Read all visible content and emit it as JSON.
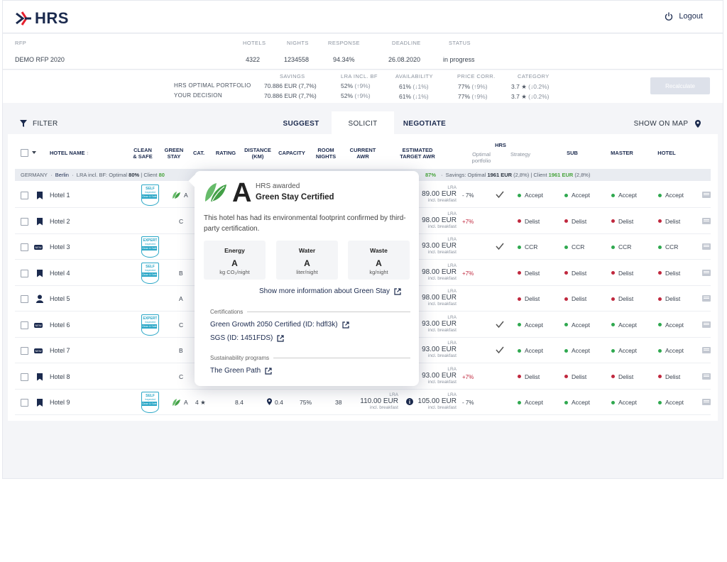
{
  "header": {
    "logo_text": "HRS",
    "logout_label": "Logout"
  },
  "rfp": {
    "labels": {
      "rfp": "RFP",
      "hotels": "HOTELS",
      "nights": "NIGHTS",
      "response": "RESPONSE",
      "deadline": "DEADLINE",
      "status": "STATUS"
    },
    "values": {
      "rfp": "DEMO RFP 2020",
      "hotels": "4322",
      "nights": "1234558",
      "response": "94.34%",
      "deadline": "26.08.2020",
      "status": "in progress"
    }
  },
  "portfolio": {
    "headers": {
      "savings": "SAVINGS",
      "lra": "LRA INCL. BF",
      "availability": "AVAILABILITY",
      "price_corr": "PRICE CORR.",
      "category": "CATEGORY"
    },
    "optimal_label": "HRS OPTIMAL PORTFOLIO",
    "decision_label": "YOUR DECISION",
    "optimal": {
      "savings": "70.886 EUR (7,7%)",
      "lra": "52%",
      "lra_delta": "(↑9%)",
      "availability": "61%",
      "availability_delta": "(↓1%)",
      "price_corr": "77%",
      "price_corr_delta": "(↑9%)",
      "category": "3.7",
      "category_delta": "(↓0.2%)"
    },
    "decision": {
      "savings": "70.886 EUR (7,7%)",
      "lra": "52%",
      "lra_delta": "(↑9%)",
      "availability": "61%",
      "availability_delta": "(↓1%)",
      "price_corr": "77%",
      "price_corr_delta": "(↑9%)",
      "category": "3.7",
      "category_delta": "(↓0.2%)"
    },
    "recalculate_label": "Recalculate"
  },
  "tabs": {
    "filter": "FILTER",
    "suggest": "SUGGEST",
    "solicit": "SOLICIT",
    "negotiate": "NEGOTIATE",
    "show_on_map": "SHOW ON MAP"
  },
  "table": {
    "headers": {
      "hotel_name": "HOTEL NAME",
      "clean_safe": "CLEAN\n& SAFE",
      "green_stay": "GREEN\nSTAY",
      "cat": "CAT.",
      "rating": "RATING",
      "distance": "DISTANCE\n(KM)",
      "capacity": "CAPACITY",
      "room_nights": "ROOM\nNIGHTS",
      "current_awr": "CURRENT\nAWR",
      "estimated_target_awr": "ESTIMATED\nTARGET AWR",
      "hrs": "HRS",
      "optimal_portfolio": "Optimal\nportfolio",
      "strategy": "Strategy",
      "sub": "SUB",
      "master": "MASTER",
      "hotel": "HOTEL"
    },
    "group": {
      "country": "GERMANY",
      "city": "Berlin",
      "lra_prefix": "LRA incl. BF: Optimal",
      "lra_optimal": "80%",
      "client_prefix": "| Client",
      "client_value": "80",
      "pct_value": "87%",
      "savings_prefix": "Savings: Optimal",
      "savings_optimal": "1961 EUR",
      "savings_optimal_pct": "(2,8%)",
      "savings_client_prefix": "| Client",
      "savings_client": "1961 EUR",
      "savings_client_pct": "(2,8%)"
    },
    "estimate_sub_label": "incl. breakfast",
    "lra_label": "LRA",
    "rows": [
      {
        "name": "Hotel 1",
        "est": "89.00 EUR",
        "pct": "- 7%",
        "pct_type": "neg",
        "optimal": true,
        "strategy": "Accept",
        "sub": "Accept",
        "master": "Accept",
        "hotel": "Accept"
      },
      {
        "name": "Hotel 2",
        "cat": "C",
        "est": "98.00 EUR",
        "pct": "+7%",
        "pct_type": "pos",
        "optimal": false,
        "strategy": "Delist",
        "sub": "Delist",
        "master": "Delist",
        "hotel": "Delist"
      },
      {
        "name": "Hotel 3",
        "est": "93.00 EUR",
        "pct": "",
        "optimal": true,
        "strategy": "CCR",
        "sub": "CCR",
        "master": "CCR",
        "hotel": "CCR"
      },
      {
        "name": "Hotel 4",
        "cat": "B",
        "est": "98.00 EUR",
        "pct": "+7%",
        "pct_type": "pos",
        "optimal": false,
        "strategy": "Delist",
        "sub": "Delist",
        "master": "Delist",
        "hotel": "Delist"
      },
      {
        "name": "Hotel 5",
        "cat": "A",
        "est": "98.00 EUR",
        "pct": "",
        "optimal": false,
        "strategy": "Delist",
        "sub": "Delist",
        "master": "Delist",
        "hotel": "Delist"
      },
      {
        "name": "Hotel 6",
        "cat": "C",
        "est": "93.00 EUR",
        "pct": "",
        "optimal": true,
        "strategy": "Accept",
        "sub": "Accept",
        "master": "Accept",
        "hotel": "Accept"
      },
      {
        "name": "Hotel 7",
        "cat": "B",
        "est": "93.00 EUR",
        "pct": "",
        "optimal": true,
        "strategy": "Accept",
        "sub": "Accept",
        "master": "Accept",
        "hotel": "Accept"
      },
      {
        "name": "Hotel 8",
        "cat": "C",
        "est": "93.00 EUR",
        "pct": "+7%",
        "pct_type": "pos",
        "optimal": false,
        "strategy": "Delist",
        "sub": "Delist",
        "master": "Delist",
        "hotel": "Delist"
      },
      {
        "name": "Hotel 9",
        "est": "105.00 EUR",
        "pct": "- 7%",
        "pct_type": "neg",
        "optimal": false,
        "strategy": "Accept",
        "sub": "Accept",
        "master": "Accept",
        "hotel": "Accept"
      }
    ],
    "row1": {
      "green_grade": "A"
    },
    "row9": {
      "green_grade": "A",
      "cat": "4",
      "rating": "8.4",
      "distance": "0.4",
      "capacity": "75%",
      "room_nights": "38",
      "current_awr": "110.00 EUR"
    }
  },
  "badges": {
    "top": "Clean & Safe",
    "self": "SELF",
    "expert": "EXPERT",
    "inspected": "Inspected",
    "new": "NEW"
  },
  "popover": {
    "grade": "A",
    "awarded": "HRS awarded",
    "certified": "Green Stay Certified",
    "description": "This hotel has had its environmental footprint confirmed by third-party certification.",
    "metrics": [
      {
        "title": "Energy",
        "grade": "A",
        "unit": "kg CO₂/night"
      },
      {
        "title": "Water",
        "grade": "A",
        "unit": "liter/night"
      },
      {
        "title": "Waste",
        "grade": "A",
        "unit": "kg/night"
      }
    ],
    "more_info": "Show more information about Green Stay",
    "certifications_label": "Certifications",
    "certifications": [
      "Green Growth 2050 Certified (ID: hdfl3k)",
      "SGS (ID: 1451FDS)"
    ],
    "programs_label": "Sustainability programs",
    "programs": [
      "The Green Path"
    ]
  },
  "colors": {
    "brand": "#1b2a4e",
    "accent_red": "#e5202e",
    "green": "#2fa84f",
    "red": "#c0283e",
    "leaf": "#4caf50"
  }
}
